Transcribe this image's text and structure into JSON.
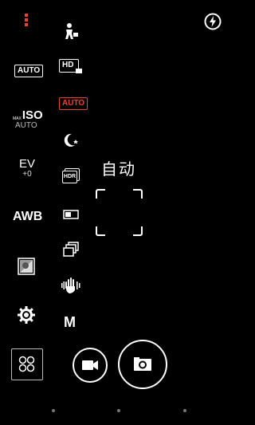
{
  "left_panel": {
    "menu_icon": "vertical-dots-icon",
    "wb_auto_label": "AUTO",
    "iso_prefix": "MAX",
    "iso_label": "ISO",
    "iso_value": "AUTO",
    "ev_label": "EV",
    "ev_value": "+0",
    "awb_label": "AWB",
    "effects_icon": "effects-icon",
    "settings_icon": "gear-icon"
  },
  "modes": {
    "selfie_icon": "person-cam-icon",
    "hd_label": "HD",
    "auto_label": "AUTO",
    "night_icon": "night-icon",
    "hdr_label": "HDR",
    "panorama_icon": "panorama-icon",
    "burst_icon": "burst-icon",
    "antishake_icon": "hand-icon",
    "manual_label": "M"
  },
  "viewfinder": {
    "mode_text": "自动"
  },
  "top_right": {
    "flash_icon": "flash-auto-icon"
  },
  "bottom": {
    "gallery_icon": "grid-icon",
    "video_icon": "video-icon",
    "shutter_icon": "camera-icon"
  },
  "colors": {
    "accent": "#e8452c",
    "background": "#000000"
  }
}
